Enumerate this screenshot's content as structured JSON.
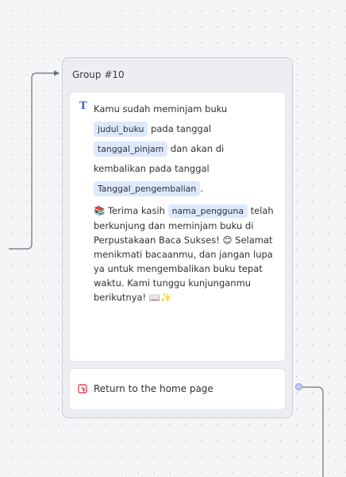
{
  "group": {
    "title": "Group #10"
  },
  "text_block": {
    "icon": "text-icon",
    "segments": [
      {
        "type": "text",
        "value": "Kamu sudah meminjam buku "
      },
      {
        "type": "var",
        "value": "judul_buku"
      },
      {
        "type": "text",
        "value": " pada tanggal "
      },
      {
        "type": "var",
        "value": "tanggal_pinjam"
      },
      {
        "type": "text",
        "value": " dan akan di kembalikan pada tanggal "
      },
      {
        "type": "var",
        "value": "Tanggal_pengembalian"
      },
      {
        "type": "text",
        "value": "."
      }
    ],
    "paragraph2": [
      {
        "type": "text",
        "value": "📚 Terima kasih "
      },
      {
        "type": "var",
        "value": "nama_pengguna"
      },
      {
        "type": "text",
        "value": " telah berkunjung dan meminjam buku di Perpustakaan Baca Sukses! 😊 Selamat menikmati bacaanmu, dan jangan lupa ya untuk mengembalikan buku tepat waktu. Kami tunggu kunjunganmu berikutnya! 📖✨"
      }
    ]
  },
  "action_block": {
    "icon": "return-icon",
    "label": "Return to the home page"
  },
  "colors": {
    "accent": "#3b63d4",
    "variable_bg": "#dde9fb",
    "action_icon": "#e0455f",
    "edge": "#6b7078"
  }
}
